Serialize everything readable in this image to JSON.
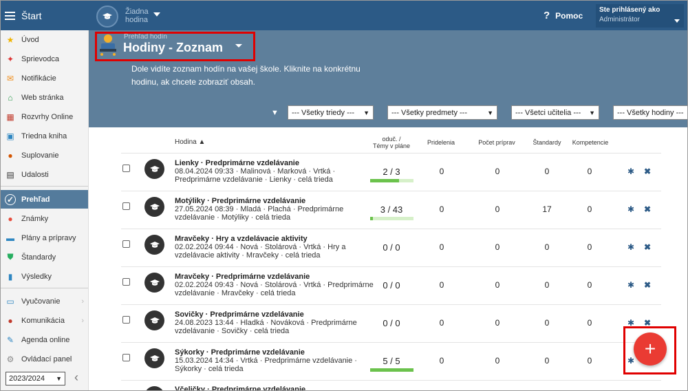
{
  "topbar": {
    "brand": "Štart",
    "term": "Žiadna hodina",
    "help": "Pomoc",
    "user_label": "Ste prihlásený ako",
    "user_role": "Administrátor"
  },
  "sidebar": {
    "items": [
      "Úvod",
      "Sprievodca",
      "Notifikácie",
      "Web stránka",
      "Rozvrhy Online",
      "Triedna kniha",
      "Suplovanie",
      "Udalosti",
      "Prehľad",
      "Známky",
      "Plány a prípravy",
      "Štandardy",
      "Výsledky",
      "Vyučovanie",
      "Komunikácia",
      "Agenda online",
      "Ovládací panel"
    ],
    "year": "2023/2024",
    "active": "Prehľad"
  },
  "header": {
    "small": "Prehľad hodín",
    "title": "Hodiny - Zoznam",
    "description": "Dole vidíte zoznam hodín na vašej škole. Kliknite na konkrétnu hodinu, ak chcete zobraziť obsah."
  },
  "filters": [
    "--- Všetky triedy ---",
    "--- Všetky predmety ---",
    "--- Všetci učitelia ---",
    "--- Všetky hodiny ---"
  ],
  "columns": {
    "hodina": "Hodina ▲",
    "odu_line1": "oduč. /",
    "odu_line2": "Témy v pláne",
    "pridelenia": "Pridelenia",
    "pocet": "Počet príprav",
    "standardy": "Štandardy",
    "kompetencie": "Kompetencie"
  },
  "rows": [
    {
      "name": "Lienky · Predprimárne vzdelávanie",
      "l1": "08.04.2024 09:33 · Malinová · Marková · Vrtká ·",
      "l2": "Predprimárne vzdelávanie · Lienky · celá trieda",
      "ratio": "2 / 3",
      "progress": 0.67,
      "pridelenia": "0",
      "pocet": "0",
      "standardy": "0",
      "kompetencie": "0"
    },
    {
      "name": "Motýliky · Predprimárne vzdelávanie",
      "l1": "27.05.2024 08:39 · Mladá · Plachá · Predprimárne",
      "l2": "vzdelávanie · Motýliky · celá trieda",
      "ratio": "3 / 43",
      "progress": 0.07,
      "pridelenia": "0",
      "pocet": "0",
      "standardy": "17",
      "kompetencie": "0"
    },
    {
      "name": "Mravčeky · Hry a vzdelávacie aktivity",
      "l1": "02.02.2024 09:44 · Nová · Stolárová · Vrtká · Hry a",
      "l2": "vzdelávacie aktivity · Mravčeky · celá trieda",
      "ratio": "0 / 0",
      "progress": null,
      "pridelenia": "0",
      "pocet": "0",
      "standardy": "0",
      "kompetencie": "0"
    },
    {
      "name": "Mravčeky · Predprimárne vzdelávanie",
      "l1": "02.02.2024 09:43 · Nová · Stolárová · Vrtká · Predprimárne",
      "l2": "vzdelávanie · Mravčeky · celá trieda",
      "ratio": "0 / 0",
      "progress": null,
      "pridelenia": "0",
      "pocet": "0",
      "standardy": "0",
      "kompetencie": "0"
    },
    {
      "name": "Sovičky · Predprimárne vzdelávanie",
      "l1": "24.08.2023 13:44 · Hladká · Nováková · Predprimárne",
      "l2": "vzdelávanie · Sovičky · celá trieda",
      "ratio": "0 / 0",
      "progress": null,
      "pridelenia": "0",
      "pocet": "0",
      "standardy": "0",
      "kompetencie": "0"
    },
    {
      "name": "Sýkorky · Predprimárne vzdelávanie",
      "l1": "15.03.2024 14:34 · Vrtká · Predprimárne vzdelávanie ·",
      "l2": "Sýkorky · celá trieda",
      "ratio": "5 / 5",
      "progress": 1.0,
      "pridelenia": "0",
      "pocet": "0",
      "standardy": "0",
      "kompetencie": "0"
    }
  ],
  "partial_row": "Včeličky · Predprimárne vzdelávanie",
  "fab": "+"
}
